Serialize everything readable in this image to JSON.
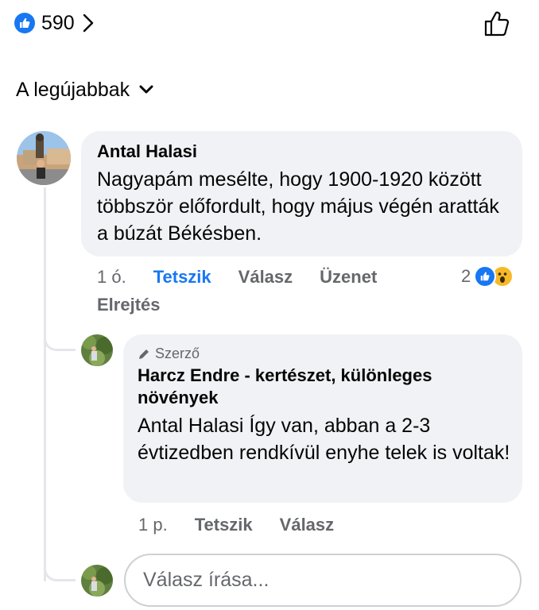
{
  "post_reactions": {
    "count": "590",
    "like_color": "#1877f2"
  },
  "sort": {
    "label": "A legújabbak"
  },
  "comments": [
    {
      "author": "Antal Halasi",
      "text": "Nagyapám mesélte, hogy 1900-1920 között többször előfordult, hogy május végén aratták a búzát Békésben.",
      "time": "1 ó.",
      "like_label": "Tetszik",
      "reply_label": "Válasz",
      "message_label": "Üzenet",
      "hide_label": "Elrejtés",
      "reaction_count": "2",
      "reaction_icons": [
        "like-icon",
        "wow-icon"
      ]
    }
  ],
  "replies": [
    {
      "badge": "Szerző",
      "author": "Harcz Endre - kertészet, különleges növények",
      "mention": "Antal Halasi",
      "text": "Így van, abban a 2-3 évtizedben rendkívül enyhe telek is voltak!",
      "time": "1 p.",
      "like_label": "Tetszik",
      "reply_label": "Válasz"
    }
  ],
  "reply_box": {
    "placeholder": "Válasz írása..."
  },
  "colors": {
    "accent": "#1877f2",
    "bubble": "#f0f2f5",
    "muted_text": "#65676b",
    "wow": "#f7b928"
  }
}
